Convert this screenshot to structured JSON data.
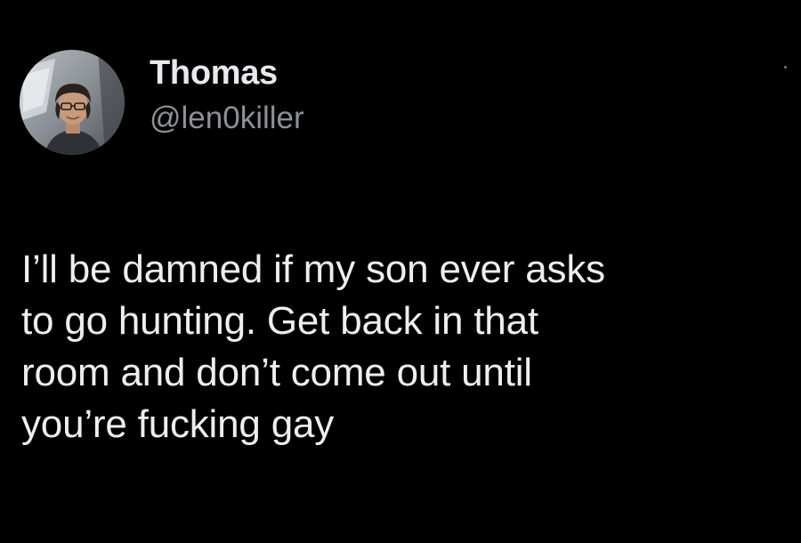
{
  "tweet": {
    "author": {
      "display_name": "Thomas",
      "handle": "@len0killer",
      "avatar_icon": "profile-photo"
    },
    "text_lines": [
      "I’ll be damned if my son ever asks",
      "to go hunting. Get back in that",
      "room and don’t come out until",
      "you’re fucking gay"
    ],
    "more_icon": "more-options-icon"
  },
  "colors": {
    "background": "#000000",
    "primary_text": "#e7e9ea",
    "secondary_text": "#8b9197"
  }
}
